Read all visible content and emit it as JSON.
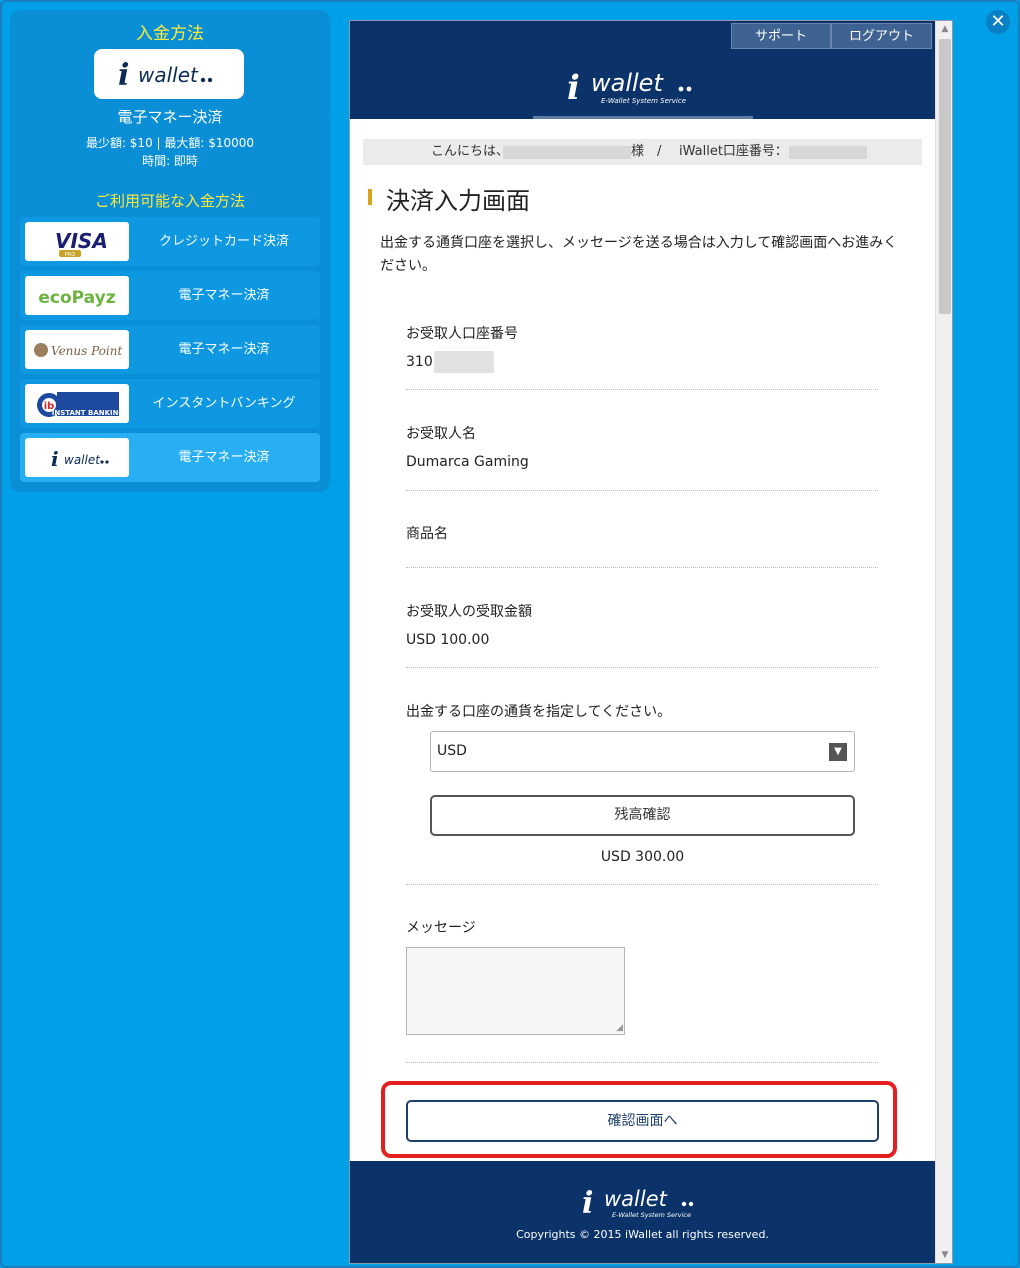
{
  "left_panel": {
    "title": "入金方法",
    "selected_logo_text": "wallet",
    "method_name": "電子マネー決済",
    "limits": "最少額: $10 | 最大額: $10000",
    "time": "時間: 即時",
    "available_title": "ご利用可能な入金方法",
    "methods": [
      {
        "logo": "VISA",
        "logo_sub": "PRO",
        "label": "クレジットカード決済"
      },
      {
        "logo": "ecoPayz",
        "label": "電子マネー決済"
      },
      {
        "logo": "Venus Point",
        "label": "電子マネー決済"
      },
      {
        "logo": "INSTANT BANKING",
        "label": "インスタントバンキング"
      },
      {
        "logo": "wallet",
        "label": "電子マネー決済"
      }
    ]
  },
  "close_label": "✕",
  "header": {
    "tabs": [
      "サポート",
      "ログアウト"
    ],
    "logo_text": "wallet",
    "logo_sub": "E-Wallet System Service"
  },
  "greeting": {
    "hello": "こんにちは、",
    "sama": "様",
    "slash": "/",
    "account_label": "iWallet口座番号："
  },
  "page_title": "決済入力画面",
  "intro": "出金する通貨口座を選択し、メッセージを送る場合は入力して確認画面へお進みください。",
  "fields": {
    "recipient_account_label": "お受取人口座番号",
    "recipient_account_value": "310",
    "recipient_name_label": "お受取人名",
    "recipient_name_value": "Dumarca Gaming",
    "product_name_label": "商品名",
    "amount_label": "お受取人の受取金額",
    "amount_value": "USD 100.00",
    "currency_prompt": "出金する口座の通貨を指定してください。",
    "currency_selected": "USD",
    "balance_button": "残高確認",
    "balance_value": "USD 300.00",
    "message_label": "メッセージ"
  },
  "confirm_button": "確認画面へ",
  "footer": {
    "logo_text": "wallet",
    "logo_sub": "E-Wallet System Service",
    "copyright": "Copyrights © 2015 iWallet all rights reserved."
  },
  "colors": {
    "background": "#00a0e9",
    "panel": "#0a8fd6",
    "accent_yellow": "#ffea3a",
    "navy": "#0b3369",
    "highlight_red": "#e41f1f"
  }
}
